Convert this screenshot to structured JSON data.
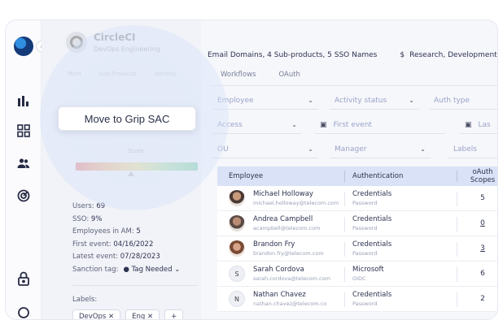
{
  "app": {
    "name": "CircleCI",
    "subtitle": "DevOps Engineering"
  },
  "left_tabs": [
    "Main",
    "Sub-Products",
    "Identity"
  ],
  "tooltip": "Move to Grip SAC",
  "score_label": "Score",
  "stats": {
    "users_label": "Users:",
    "users_value": "69",
    "sso_label": "SSO:",
    "sso_value": "9%",
    "employees_label": "Employees in AM:",
    "employees_value": "5",
    "first_event_label": "First event:",
    "first_event_value": "04/16/2022",
    "latest_event_label": "Latest event:",
    "latest_event_value": "07/28/2023",
    "sanction_label": "Sanction tag:",
    "sanction_value": "Tag Needed"
  },
  "labels": {
    "title": "Labels:",
    "chips": [
      "DevOps ✕",
      "Eng ✕",
      "+"
    ]
  },
  "summary": {
    "domains": "Email Domains, 4 Sub-products, 5 SSO Names",
    "departments": "Research, Development"
  },
  "tabs": [
    "Workflows",
    "OAuth"
  ],
  "filters": {
    "employee": "Employee",
    "activity_status": "Activity status",
    "auth_type": "Auth type",
    "access": "Access",
    "first_event": "First event",
    "last_event": "Las",
    "ou": "OU",
    "manager": "Manager",
    "labels": "Labels"
  },
  "table": {
    "columns": [
      "Employee",
      "Authentication",
      "oAuth",
      "Scopes"
    ],
    "rows": [
      {
        "name": "Michael Holloway",
        "email": "michael.holloway@telecom.com",
        "auth": "Credentials",
        "auth_sub": "Password",
        "scopes": "5",
        "initial": ""
      },
      {
        "name": "Andrea Campbell",
        "email": "acampbell@telecom.com",
        "auth": "Credentials",
        "auth_sub": "Password",
        "scopes": "0",
        "initial": ""
      },
      {
        "name": "Brandon Fry",
        "email": "brandon.fry@telecom.com",
        "auth": "Credentials",
        "auth_sub": "Password",
        "scopes": "3",
        "initial": ""
      },
      {
        "name": "Sarah Cordova",
        "email": "sarah.cordova@telecom.com",
        "auth": "Microsoft",
        "auth_sub": "OIDC",
        "scopes": "6",
        "initial": "S"
      },
      {
        "name": "Nathan Chavez",
        "email": "nathan.chavez@telecom.co",
        "auth": "Credentials",
        "auth_sub": "Password",
        "scopes": "2",
        "initial": "N"
      }
    ]
  },
  "colors": {
    "accent": "#2f8ee0",
    "table_header": "#d9e2f6",
    "text": "#2d3250"
  }
}
